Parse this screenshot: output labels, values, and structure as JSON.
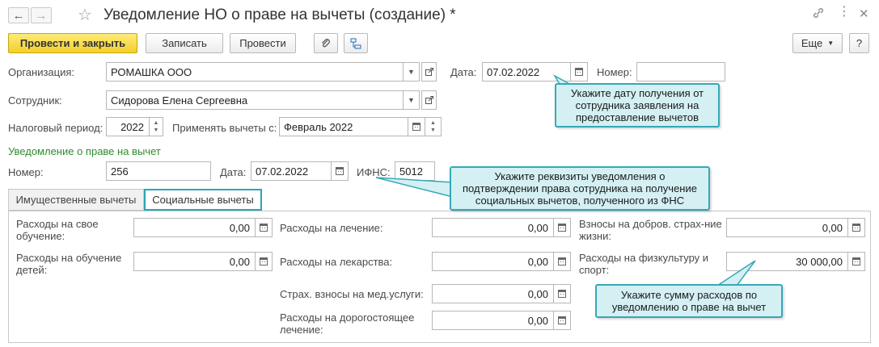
{
  "header": {
    "title": "Уведомление НО о праве на вычеты (создание) *",
    "back_glyph": "←",
    "forward_glyph": "→"
  },
  "toolbar": {
    "post_close": "Провести и закрыть",
    "save": "Записать",
    "post": "Провести",
    "more": "Еще",
    "help": "?"
  },
  "form": {
    "org_label": "Организация:",
    "org_value": "РОМАШКА ООО",
    "date_label": "Дата:",
    "date_value": "07.02.2022",
    "number_label": "Номер:",
    "number_value": "",
    "employee_label": "Сотрудник:",
    "employee_value": "Сидорова Елена Сергеевна",
    "tax_period_label": "Налоговый период:",
    "tax_period_value": "2022",
    "apply_from_label": "Применять вычеты с:",
    "apply_from_value": "Февраль 2022"
  },
  "notice": {
    "section_title": "Уведомление о праве на вычет",
    "number_label": "Номер:",
    "number_value": "256",
    "date_label": "Дата:",
    "date_value": "07.02.2022",
    "ifns_label": "ИФНС:",
    "ifns_value": "5012"
  },
  "tabs": [
    {
      "label": "Имущественные вычеты",
      "active": false
    },
    {
      "label": "Социальные вычеты",
      "active": true
    }
  ],
  "social": {
    "own_education_label": "Расходы на свое обучение:",
    "own_education_value": "0,00",
    "children_education_label": "Расходы на обучение детей:",
    "children_education_value": "0,00",
    "treatment_label": "Расходы на лечение:",
    "treatment_value": "0,00",
    "medicine_label": "Расходы на лекарства:",
    "medicine_value": "0,00",
    "med_insurance_label": "Страх. взносы на мед.услуги:",
    "med_insurance_value": "0,00",
    "expensive_treatment_label": "Расходы на дорогостоящее лечение:",
    "expensive_treatment_value": "0,00",
    "life_insurance_label": "Взносы на добров. страх-ние жизни:",
    "life_insurance_value": "0,00",
    "sport_label": "Расходы на физкультуру и спорт:",
    "sport_value": "30 000,00"
  },
  "tooltips": {
    "date_hint": "Укажите дату получения от сотрудника заявления на предоставление вычетов",
    "notice_hint": "Укажите реквизиты уведомления о подтверждении права сотрудника на получение социальных вычетов, полученного из ФНС",
    "amount_hint": "Укажите сумму расходов по уведомлению о праве на вычет"
  },
  "colors": {
    "primary_button": "#f4cf2b",
    "tooltip_bg": "#d4f0f3",
    "tooltip_border": "#36a8b7",
    "section_title": "#2e8b2e"
  }
}
